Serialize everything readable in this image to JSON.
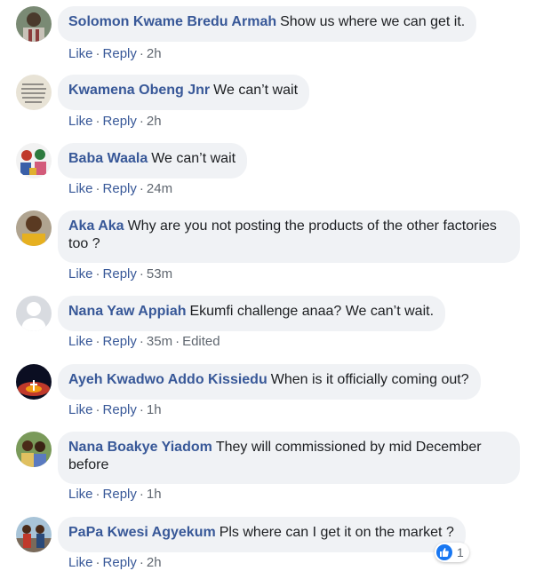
{
  "labels": {
    "like": "Like",
    "reply": "Reply",
    "separator": "·",
    "edited": "Edited"
  },
  "comments": [
    {
      "author": "Solomon Kwame Bredu Armah",
      "text": "Show us where we can get it.",
      "time": "2h"
    },
    {
      "author": "Kwamena Obeng Jnr",
      "text": "We can’t wait",
      "time": "2h"
    },
    {
      "author": "Baba Waala",
      "text": "We can’t wait",
      "time": "24m"
    },
    {
      "author": "Aka Aka",
      "text": "Why are you not posting the products of the other factories too ?",
      "time": "53m"
    },
    {
      "author": "Nana Yaw Appiah",
      "text": "Ekumfi challenge anaa? We can’t wait.",
      "time": "35m"
    },
    {
      "author": "Ayeh Kwadwo Addo Kissiedu",
      "text": "When is it officially coming out?",
      "time": "1h"
    },
    {
      "author": "Nana Boakye Yiadom",
      "text": "They will commissioned by mid December before",
      "time": "1h"
    },
    {
      "author": "PaPa Kwesi Agyekum",
      "text": "Pls where can I get it on the market ?",
      "time": "2h"
    }
  ],
  "reaction": {
    "icon": "like-icon",
    "count": "1",
    "color": "#1877f2"
  },
  "colors": {
    "name": "#385898",
    "bubble": "#f0f2f5",
    "meta": "#606770"
  }
}
